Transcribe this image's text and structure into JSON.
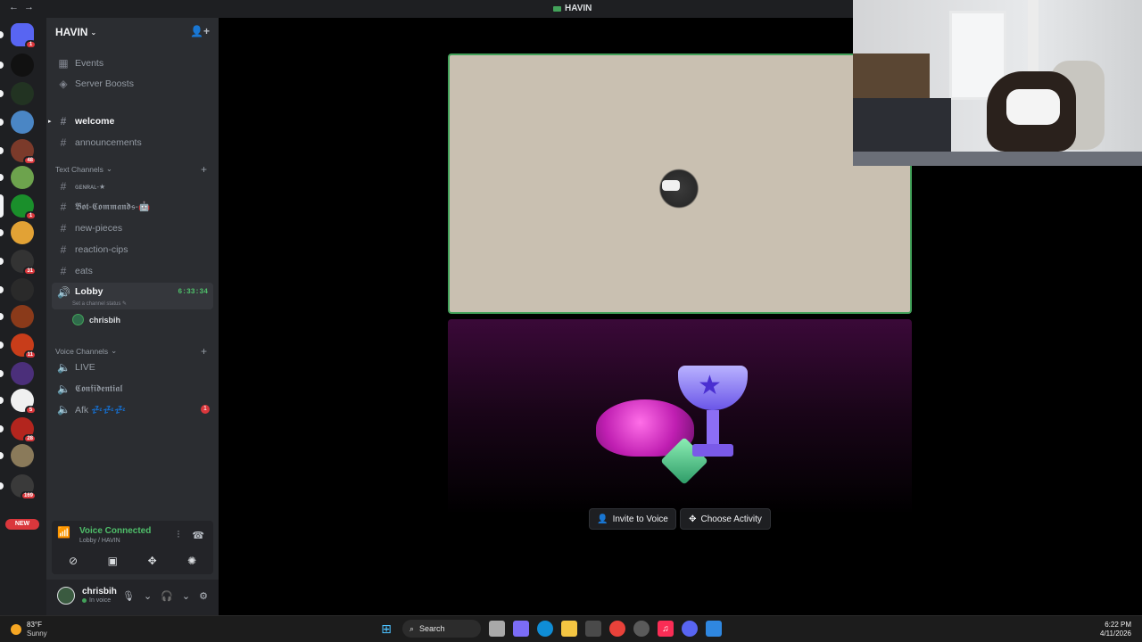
{
  "window": {
    "title": "HAVIN",
    "nav_back": "←",
    "nav_forward": "→"
  },
  "server_rail": {
    "items": [
      {
        "name": "discord-home-icon",
        "badge": "1",
        "color": "#5865f2"
      },
      {
        "name": "server-bh",
        "badge": "",
        "color": "#111111"
      },
      {
        "name": "server-2",
        "badge": "",
        "color": "#223322"
      },
      {
        "name": "server-3",
        "badge": "",
        "color": "#4a86c5"
      },
      {
        "name": "server-4",
        "badge": "48",
        "color": "#7b3a2a"
      },
      {
        "name": "server-5",
        "badge": "",
        "color": "#6da34d"
      },
      {
        "name": "server-havin",
        "badge": "1",
        "color": "#1a8f2b"
      },
      {
        "name": "server-7",
        "badge": "",
        "color": "#e2a235"
      },
      {
        "name": "server-8",
        "badge": "31",
        "color": "#333333"
      },
      {
        "name": "server-9",
        "badge": "",
        "color": "#2a2a2a"
      },
      {
        "name": "server-10",
        "badge": "",
        "color": "#8a3a1a"
      },
      {
        "name": "server-11",
        "badge": "11",
        "color": "#c83d1a"
      },
      {
        "name": "server-12",
        "badge": "",
        "color": "#4b2f7a"
      },
      {
        "name": "server-13",
        "badge": "5",
        "color": "#f0f0f0"
      },
      {
        "name": "server-14",
        "badge": "28",
        "color": "#b3251e"
      },
      {
        "name": "server-15",
        "badge": "",
        "color": "#8a7a5a"
      },
      {
        "name": "server-16",
        "badge": "169",
        "color": "#3a3a3a"
      }
    ],
    "new_label": "NEW"
  },
  "sidebar": {
    "server_name": "HAVIN",
    "invite_icon": "add-member-icon",
    "top_items": [
      {
        "label": "Events",
        "icon": "calendar-icon"
      },
      {
        "label": "Server Boosts",
        "icon": "boost-icon"
      }
    ],
    "pinned_channels": [
      {
        "label": "welcome",
        "bright": true
      },
      {
        "label": "announcements",
        "bright": false
      }
    ],
    "text_category": "Text Channels",
    "text_channels": [
      {
        "label": "ɢᴇɴʀᴀʟ-★"
      },
      {
        "label": "𝕭𝖔𝖙-𝕮𝖔𝖒𝖒𝖆𝖓𝖉𝖘-🤖"
      },
      {
        "label": "new-pieces"
      },
      {
        "label": "reaction-cips"
      },
      {
        "label": "eats"
      }
    ],
    "active_voice": {
      "label": "Lobby",
      "time": "6:33:34",
      "status_hint": "Set a channel status ✎",
      "member": "chrisbih"
    },
    "voice_category": "Voice Channels",
    "voice_channels": [
      {
        "label": "LIVE",
        "badge": ""
      },
      {
        "label": "𝕮𝖔𝖓𝖋𝖎𝖉𝖊𝖓𝖙𝖎𝖆𝖑",
        "badge": ""
      },
      {
        "label": "Afk 💤💤💤",
        "badge": "1"
      }
    ]
  },
  "voice_panel": {
    "status": "Voice Connected",
    "location": "Lobby / HAVIN",
    "buttons": [
      "camera-off-icon",
      "screen-share-icon",
      "activity-icon",
      "soundboard-icon"
    ]
  },
  "user_panel": {
    "name": "chrisbih",
    "status": "In voice"
  },
  "stage": {
    "invite_label": "Invite to Voice",
    "activity_label": "Choose Activity"
  },
  "taskbar": {
    "temp": "83°F",
    "condition": "Sunny",
    "search_label": "Search",
    "time": "6:22 PM",
    "date": "4/11/2026"
  }
}
